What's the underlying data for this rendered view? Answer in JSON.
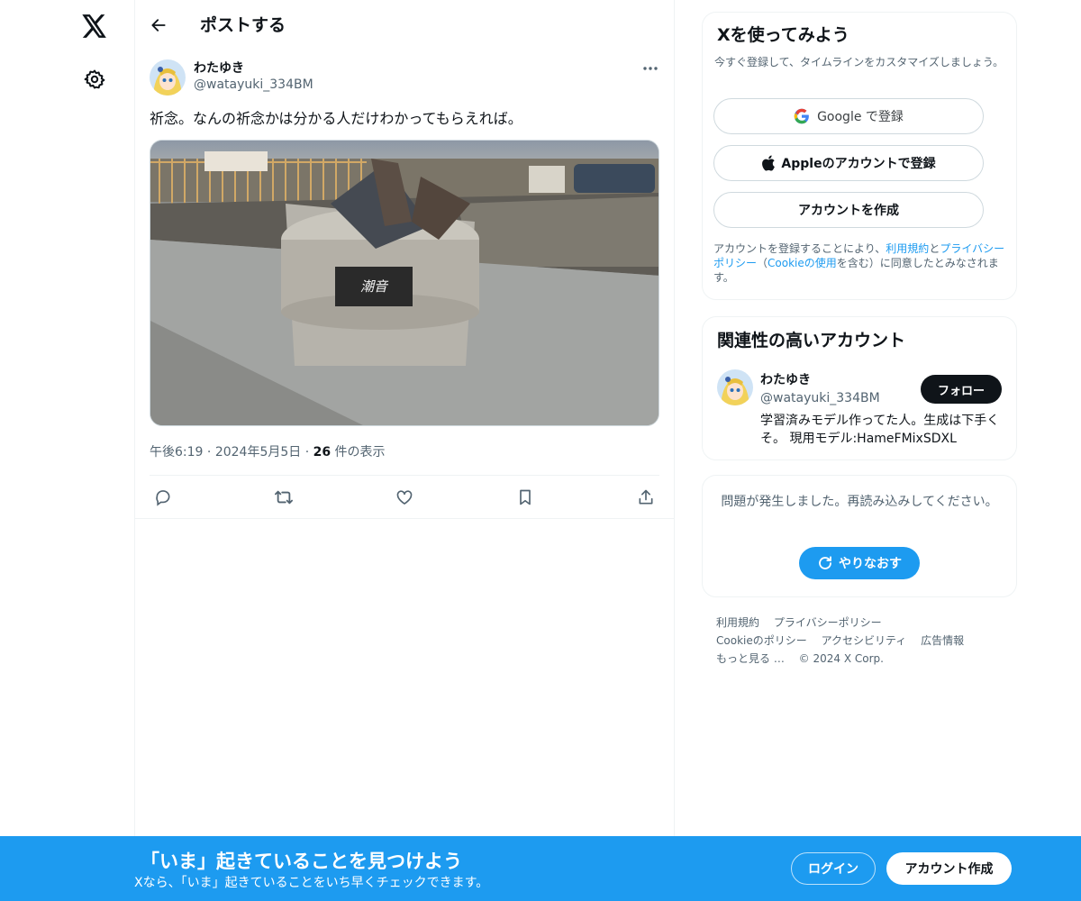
{
  "nav": {
    "logo_icon": "x-logo-icon",
    "settings_icon": "gear-icon"
  },
  "header": {
    "title": "ポストする",
    "back_icon": "arrow-left-icon"
  },
  "post": {
    "author_name": "わたゆき",
    "author_handle": "@watayuki_334BM",
    "text": "祈念。なんの祈念かは分かる人だけわかってもらえれば。",
    "image_alt": "潮音",
    "time": "午後6:19",
    "date": "2024年5月5日",
    "views_count": "26",
    "views_label": " 件の表示",
    "more_icon": "more-horizontal-icon",
    "actions": [
      "reply-icon",
      "repost-icon",
      "like-icon",
      "bookmark-icon",
      "share-icon"
    ]
  },
  "signup": {
    "title": "Xを使ってみよう",
    "subtitle": "今すぐ登録して、タイムラインをカスタマイズしましょう。",
    "google_label": "Google で登録",
    "apple_label": "Appleのアカウントで登録",
    "create_label": "アカウントを作成",
    "legal_prefix": "アカウントを登録することにより、",
    "legal_terms": "利用規約",
    "legal_and": "と",
    "legal_privacy": "プライバシーポリシー",
    "legal_open": "（",
    "legal_cookie": "Cookieの使用",
    "legal_suffix": "を含む）に同意したとみなされます。"
  },
  "related": {
    "title": "関連性の高いアカウント",
    "name": "わたゆき",
    "handle": "@watayuki_334BM",
    "follow_label": "フォロー",
    "bio": "学習済みモデル作ってた人。生成は下手くそ。 現用モデル:HameFMixSDXL"
  },
  "error": {
    "message": "問題が発生しました。再読み込みしてください。",
    "retry_label": "やりなおす"
  },
  "footer": {
    "links": [
      "利用規約",
      "プライバシーポリシー",
      "Cookieのポリシー",
      "アクセシビリティ",
      "広告情報",
      "もっと見る …"
    ],
    "copyright": "© 2024 X Corp."
  },
  "bottom_banner": {
    "title": "「いま」起きていることを見つけよう",
    "subtitle": "Xなら、「いま」起きていることをいち早くチェックできます。",
    "login_label": "ログイン",
    "signup_label": "アカウント作成"
  },
  "colors": {
    "accent": "#1d9bf0",
    "text": "#0f1419",
    "muted": "#536471",
    "border": "#eff3f4"
  }
}
